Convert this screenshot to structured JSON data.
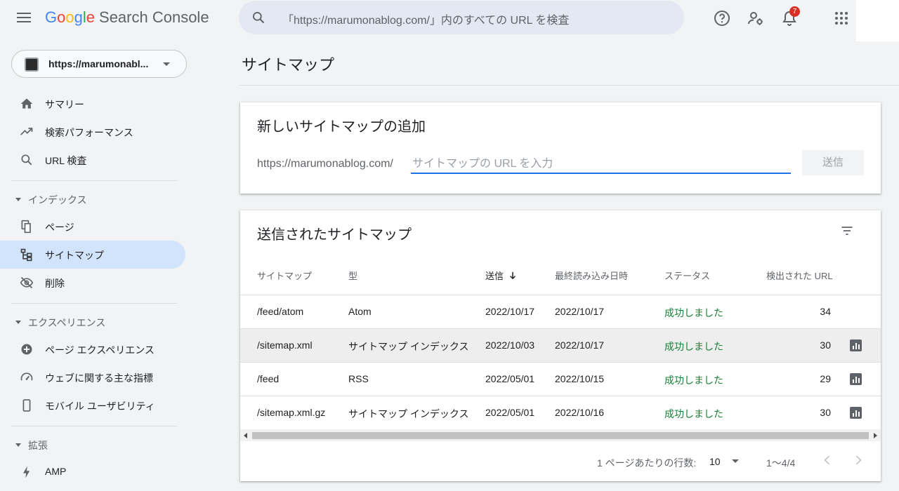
{
  "header": {
    "logo_letters": [
      "G",
      "o",
      "o",
      "g",
      "l",
      "e"
    ],
    "product": "Search Console",
    "search_placeholder": "「https://marumonablog.com/」内のすべての URL を検査",
    "notification_count": "7"
  },
  "sidebar": {
    "property": "https://marumonabl...",
    "items_top": [
      {
        "label": "サマリー",
        "icon": "home-icon"
      },
      {
        "label": "検索パフォーマンス",
        "icon": "trending-up-icon"
      },
      {
        "label": "URL 検査",
        "icon": "search-icon"
      }
    ],
    "section_index": "インデックス",
    "items_index": [
      {
        "label": "ページ",
        "icon": "pages-icon"
      },
      {
        "label": "サイトマップ",
        "icon": "sitemap-icon",
        "active": true
      },
      {
        "label": "削除",
        "icon": "visibility-off-icon"
      }
    ],
    "section_experience": "エクスペリエンス",
    "items_experience": [
      {
        "label": "ページ エクスペリエンス",
        "icon": "plus-circle-icon"
      },
      {
        "label": "ウェブに関する主な指標",
        "icon": "speed-gauge-icon"
      },
      {
        "label": "モバイル ユーザビリティ",
        "icon": "phone-icon"
      }
    ],
    "section_extensions": "拡張",
    "items_extensions": [
      {
        "label": "AMP",
        "icon": "bolt-icon"
      }
    ]
  },
  "main": {
    "page_title": "サイトマップ",
    "add_card": {
      "title": "新しいサイトマップの追加",
      "url_prefix": "https://marumonablog.com/",
      "input_placeholder": "サイトマップの URL を入力",
      "submit_label": "送信"
    },
    "submitted_card": {
      "title": "送信されたサイトマップ",
      "columns": {
        "sitemap": "サイトマップ",
        "type": "型",
        "submitted": "送信",
        "last_read": "最終読み込み日時",
        "status": "ステータス",
        "discovered_urls": "検出された URL"
      },
      "rows": [
        {
          "sitemap": "/feed/atom",
          "type": "Atom",
          "submitted": "2022/10/17",
          "last_read": "2022/10/17",
          "status": "成功しました",
          "urls": "34",
          "chart": false
        },
        {
          "sitemap": "/sitemap.xml",
          "type": "サイトマップ インデックス",
          "submitted": "2022/10/03",
          "last_read": "2022/10/17",
          "status": "成功しました",
          "urls": "30",
          "chart": true
        },
        {
          "sitemap": "/feed",
          "type": "RSS",
          "submitted": "2022/05/01",
          "last_read": "2022/10/15",
          "status": "成功しました",
          "urls": "29",
          "chart": true
        },
        {
          "sitemap": "/sitemap.xml.gz",
          "type": "サイトマップ インデックス",
          "submitted": "2022/05/01",
          "last_read": "2022/10/16",
          "status": "成功しました",
          "urls": "30",
          "chart": true
        }
      ],
      "footer": {
        "rows_per_page_label": "1 ページあたりの行数:",
        "rows_per_page_value": "10",
        "range": "1〜4/4"
      }
    }
  },
  "colors": {
    "accent": "#1a73e8",
    "active_nav": "#d2e3fc",
    "success": "#188038",
    "badge": "#d93025"
  }
}
